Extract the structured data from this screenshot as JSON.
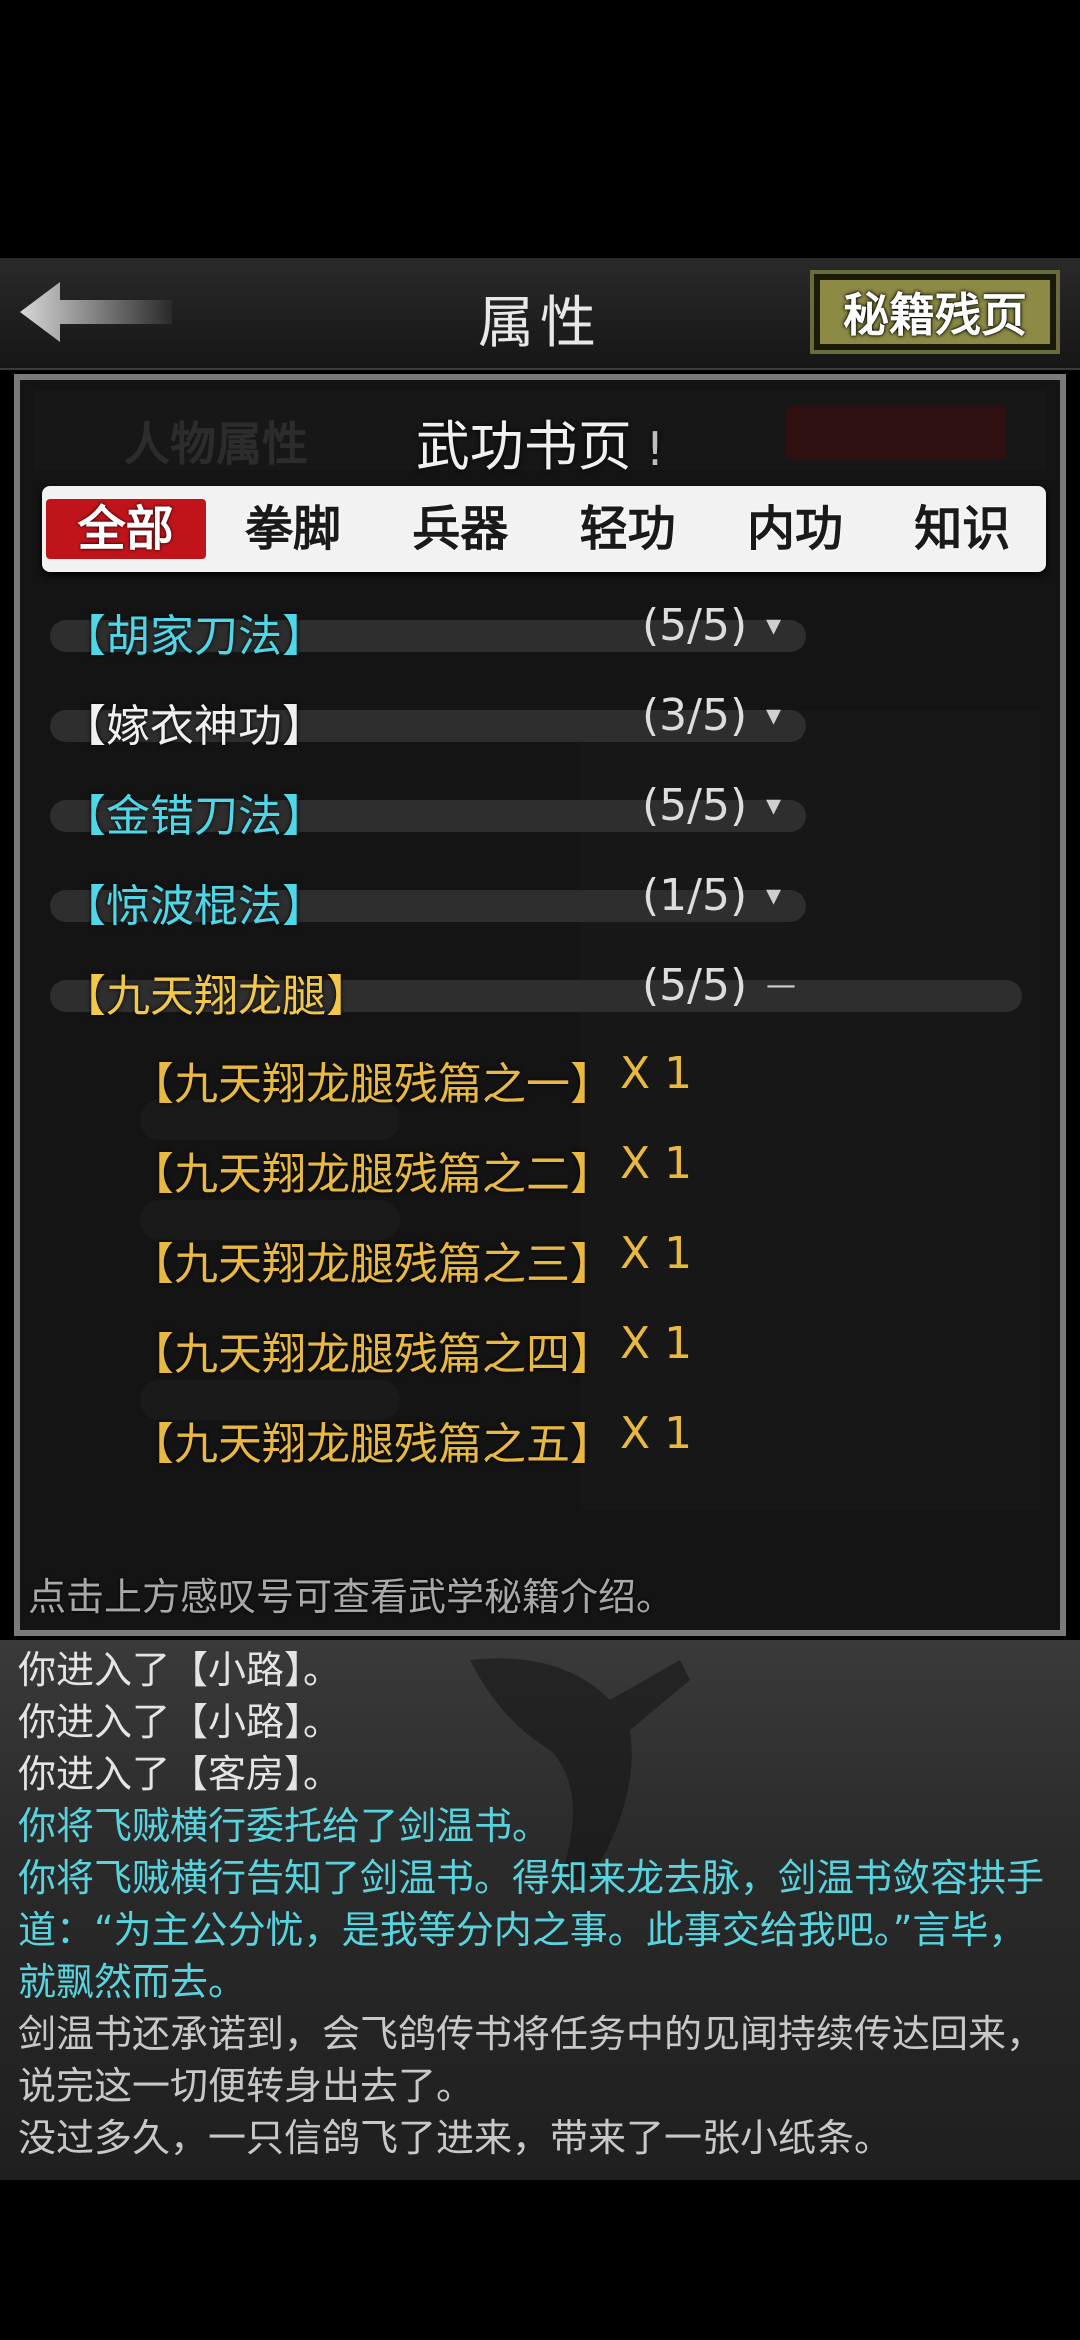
{
  "header": {
    "title": "属性",
    "fragment_button": "秘籍残页"
  },
  "ghost": {
    "tab_char_attr": "人物属性"
  },
  "dialog": {
    "title": "武功书页",
    "info_icon": "!",
    "tabs": [
      "全部",
      "拳脚",
      "兵器",
      "轻功",
      "内功",
      "知识"
    ],
    "active_tab": "全部",
    "skills": [
      {
        "name": "【胡家刀法】",
        "count": "(5/5)",
        "color": "cyan",
        "toggle": "▾"
      },
      {
        "name": "【嫁衣神功】",
        "count": "(3/5)",
        "color": "white",
        "toggle": "▾"
      },
      {
        "name": "【金错刀法】",
        "count": "(5/5)",
        "color": "cyan",
        "toggle": "▾"
      },
      {
        "name": "【惊波棍法】",
        "count": "(1/5)",
        "color": "cyan",
        "toggle": "▾"
      },
      {
        "name": "【九天翔龙腿】",
        "count": "(5/5)",
        "color": "gold",
        "toggle": "—"
      }
    ],
    "fragments": [
      {
        "name": "【九天翔龙腿残篇之一】",
        "qty": "X 1"
      },
      {
        "name": "【九天翔龙腿残篇之二】",
        "qty": "X 1"
      },
      {
        "name": "【九天翔龙腿残篇之三】",
        "qty": "X 1"
      },
      {
        "name": "【九天翔龙腿残篇之四】",
        "qty": "X 1"
      },
      {
        "name": "【九天翔龙腿残篇之五】",
        "qty": "X 1"
      }
    ],
    "hint": "点击上方感叹号可查看武学秘籍介绍。"
  },
  "log": [
    {
      "text": "你进入了【小路】。",
      "color": "white"
    },
    {
      "text": "你进入了【小路】。",
      "color": "white"
    },
    {
      "text": "你进入了【客房】。",
      "color": "white"
    },
    {
      "text": "你将飞贼横行委托给了剑温书。",
      "color": "cyan"
    },
    {
      "text": "你将飞贼横行告知了剑温书。得知来龙去脉，剑温书敛容拱手道：“为主公分忧，是我等分内之事。此事交给我吧。”言毕，就飘然而去。",
      "color": "cyan"
    },
    {
      "text": "剑温书还承诺到，会飞鸽传书将任务中的见闻持续传达回来，说完这一切便转身出去了。",
      "color": "gray"
    },
    {
      "text": "没过多久，一只信鸽飞了进来，带来了一张小纸条。",
      "color": "gray"
    }
  ],
  "colors": {
    "cyan": "#4fd7e8",
    "gold": "#f1c84a",
    "active_tab": "#c0141a",
    "fragment_button": "#8c8a45"
  }
}
